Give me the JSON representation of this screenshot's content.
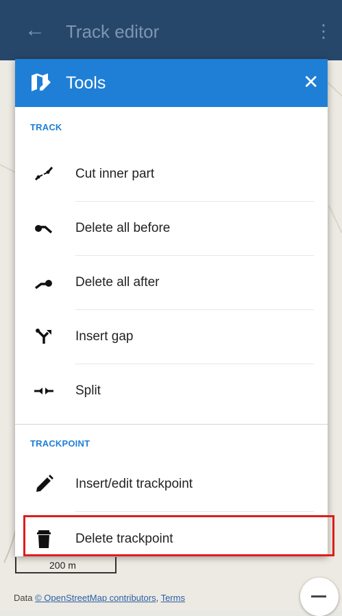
{
  "topbar": {
    "back_icon": "arrow-left-icon",
    "title": "Track editor",
    "more_icon": "more-vert-icon"
  },
  "dialog": {
    "header_icon": "map-edit-icon",
    "title": "Tools",
    "close_symbol": "✕",
    "sections": [
      {
        "label": "TRACK",
        "items": [
          {
            "label": "Cut inner part",
            "icon": "cut-inner-part-icon"
          },
          {
            "label": "Delete all before",
            "icon": "delete-before-icon"
          },
          {
            "label": "Delete all after",
            "icon": "delete-after-icon"
          },
          {
            "label": "Insert gap",
            "icon": "insert-gap-icon"
          },
          {
            "label": "Split",
            "icon": "split-icon"
          }
        ]
      },
      {
        "label": "TRACKPOINT",
        "items": [
          {
            "label": "Insert/edit trackpoint",
            "icon": "pencil-icon"
          },
          {
            "label": "Delete trackpoint",
            "icon": "trash-icon"
          }
        ]
      }
    ]
  },
  "map": {
    "scale": "200 m",
    "attribution_prefix": "Data ",
    "attribution_link": "© OpenStreetMap contributors",
    "attribution_sep": ", ",
    "attribution_terms": "Terms"
  },
  "highlight_color": "#e01b1b",
  "accent_color": "#1f7fd6"
}
